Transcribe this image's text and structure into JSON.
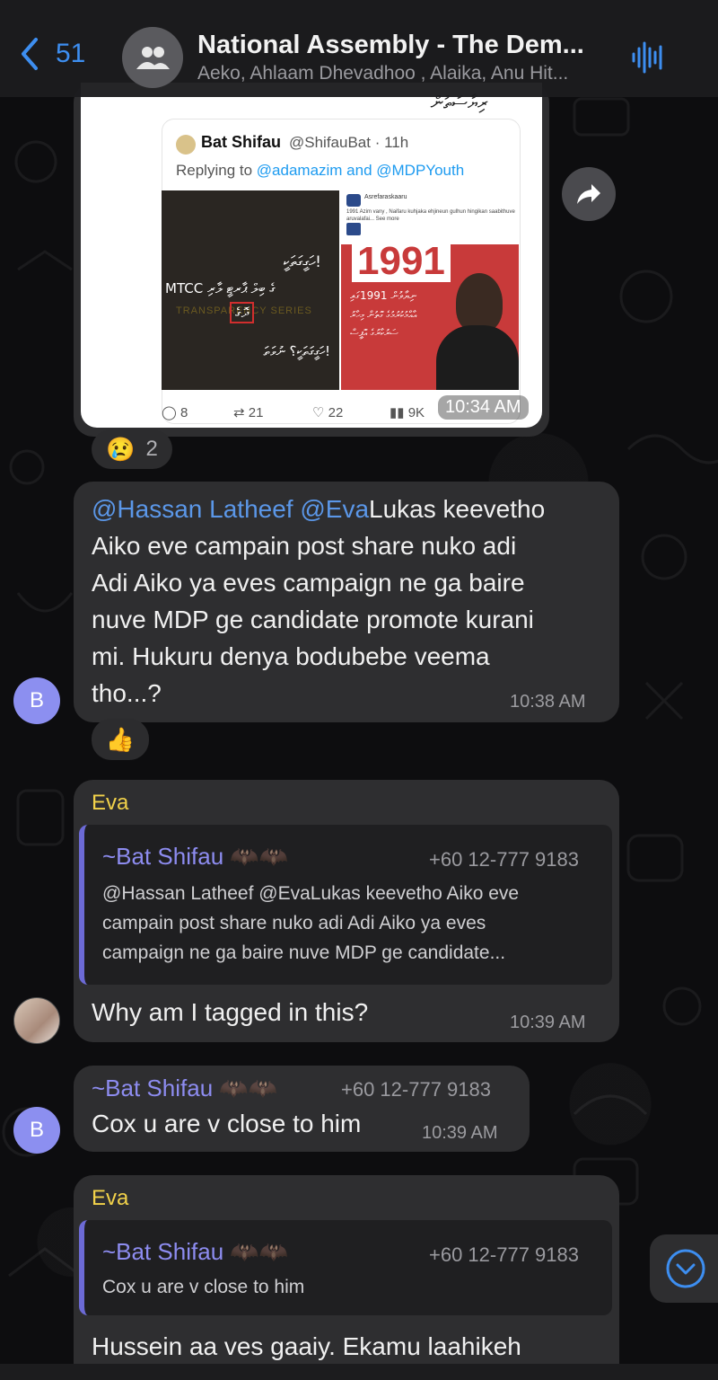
{
  "header": {
    "back_count": "51",
    "title": "National Assembly - The Dem...",
    "members": "Aeko, Ahlaam Dhevadhoo , Alaika, Anu Hit..."
  },
  "tweet": {
    "top_script": "ރިޔާސަތުން",
    "author_name": "Bat Shifau",
    "author_handle": "@ShifauBat · 11h",
    "replying_prefix": "Replying to ",
    "replying_to": "@adamazim and @MDPYouth",
    "left_lines": [
      "ހަގީގަތަކީ!",
      "MTCC ގެ ބިލް ޕާރޓީ ލާރި",
      "ދޮގެ",
      "ހަގީގަތަކީ؟ ނުވަތަ!"
    ],
    "left_tag": "TRANSPARENCY SERIES",
    "right_header_name": "Asrefaraskaaru",
    "right_caption": "1991 Azim vany , Naifaru kuhjaka ehjineun gulhun hingikan saabithuve aruvalafai... See more",
    "year": "1991",
    "right_lines": [
      "ނިޔާވުން 1991ގައި",
      "އާއްމުކުރުމުގެ ގޮތުން މިހާރު",
      "ސަރުކާރުގެ އޮފީސް"
    ],
    "stats": {
      "replies": "8",
      "retweets": "21",
      "likes": "22",
      "views": "9K"
    },
    "time": "10:34 AM"
  },
  "reaction1": {
    "emoji": "😢",
    "count": "2"
  },
  "msg1": {
    "mention1": "@Hassan Latheef",
    "mention2": "@Eva",
    "lines": [
      "Lukas keevetho",
      "Aiko eve campain post share nuko adi",
      "Adi Aiko ya eves campaign ne ga baire",
      "nuve MDP ge candidate promote kurani",
      "mi. Hukuru denya bodubebe veema",
      "tho...?"
    ],
    "time": "10:38 AM",
    "avatar": "B"
  },
  "reaction2": {
    "emoji": "👍"
  },
  "msg2": {
    "sender": "Eva",
    "reply_name": "~Bat Shifau",
    "reply_phone": "+60 12-777 9183",
    "reply_lines": [
      "@Hassan Latheef @EvaLukas keevetho Aiko eve",
      "campain post share nuko adi Adi Aiko ya eves",
      "campaign ne ga baire nuve MDP ge candidate..."
    ],
    "text": "Why am I tagged in this?",
    "time": "10:39 AM"
  },
  "msg3": {
    "name": "~Bat Shifau",
    "phone": "+60 12-777 9183",
    "text": "Cox u are v close to him",
    "time": "10:39 AM",
    "avatar": "B"
  },
  "msg4": {
    "sender": "Eva",
    "reply_name": "~Bat Shifau",
    "reply_phone": "+60 12-777 9183",
    "reply_text": "Cox u are v close to him",
    "text": "Hussein aa ves gaaiy. Ekamu laahikeh"
  },
  "colors": {
    "accent": "#3d8ef0",
    "mention": "#5b97e8",
    "sender_eva": "#f2d24a",
    "sender_bat": "#8d8cf0",
    "bubble": "#2e2e30"
  }
}
